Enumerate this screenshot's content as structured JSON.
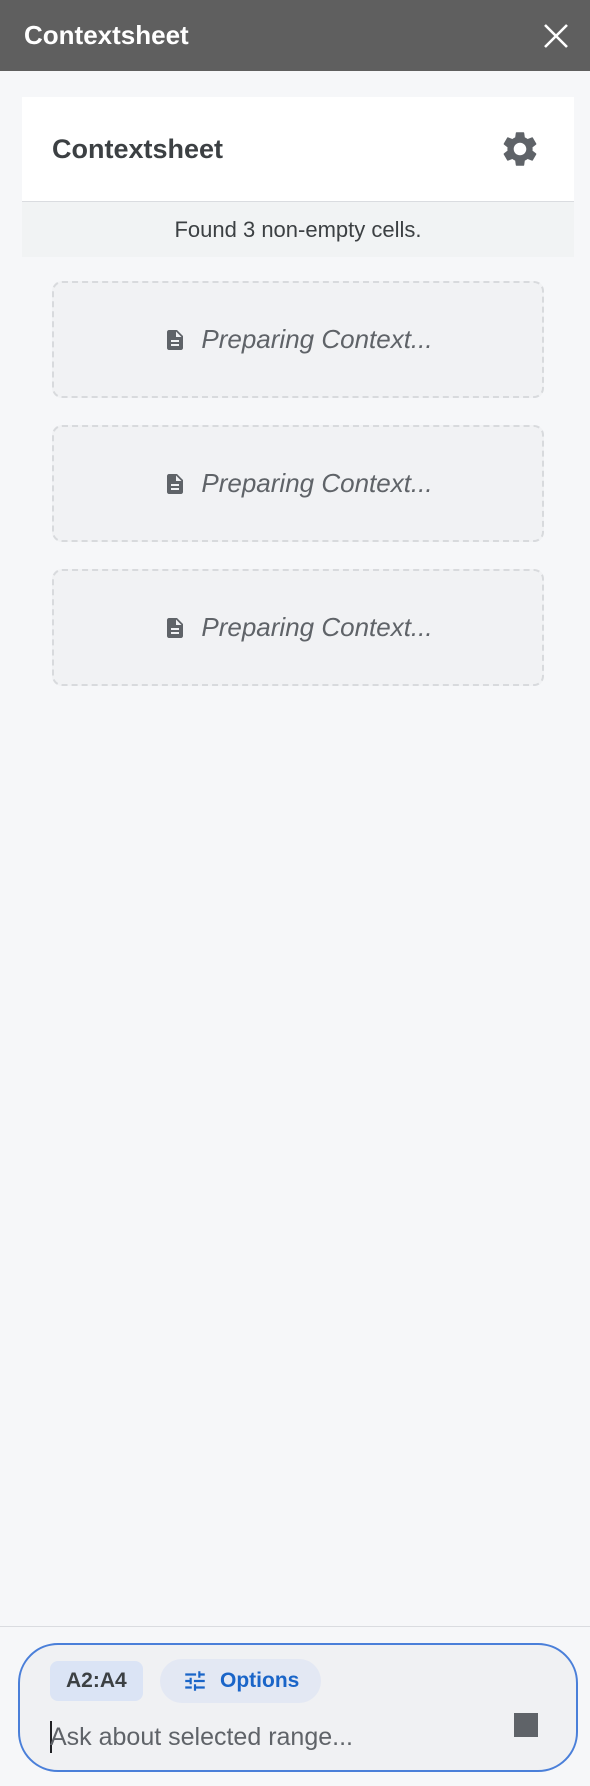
{
  "window": {
    "title": "Contextsheet"
  },
  "header": {
    "title": "Contextsheet",
    "status": "Found 3 non-empty cells."
  },
  "context_items": [
    {
      "label": "Preparing Context..."
    },
    {
      "label": "Preparing Context..."
    },
    {
      "label": "Preparing Context..."
    }
  ],
  "composer": {
    "range_chip": "A2:A4",
    "options_label": "Options",
    "input_placeholder": "Ask about selected range...",
    "input_value": ""
  },
  "icons": {
    "close": "close-icon",
    "settings": "gear-icon",
    "document": "document-icon",
    "tune": "tune-icon",
    "stop": "stop-icon"
  },
  "colors": {
    "titlebar": "#5f5f5f",
    "accent": "#1a65c8",
    "composer_border": "#4a7fd9"
  }
}
